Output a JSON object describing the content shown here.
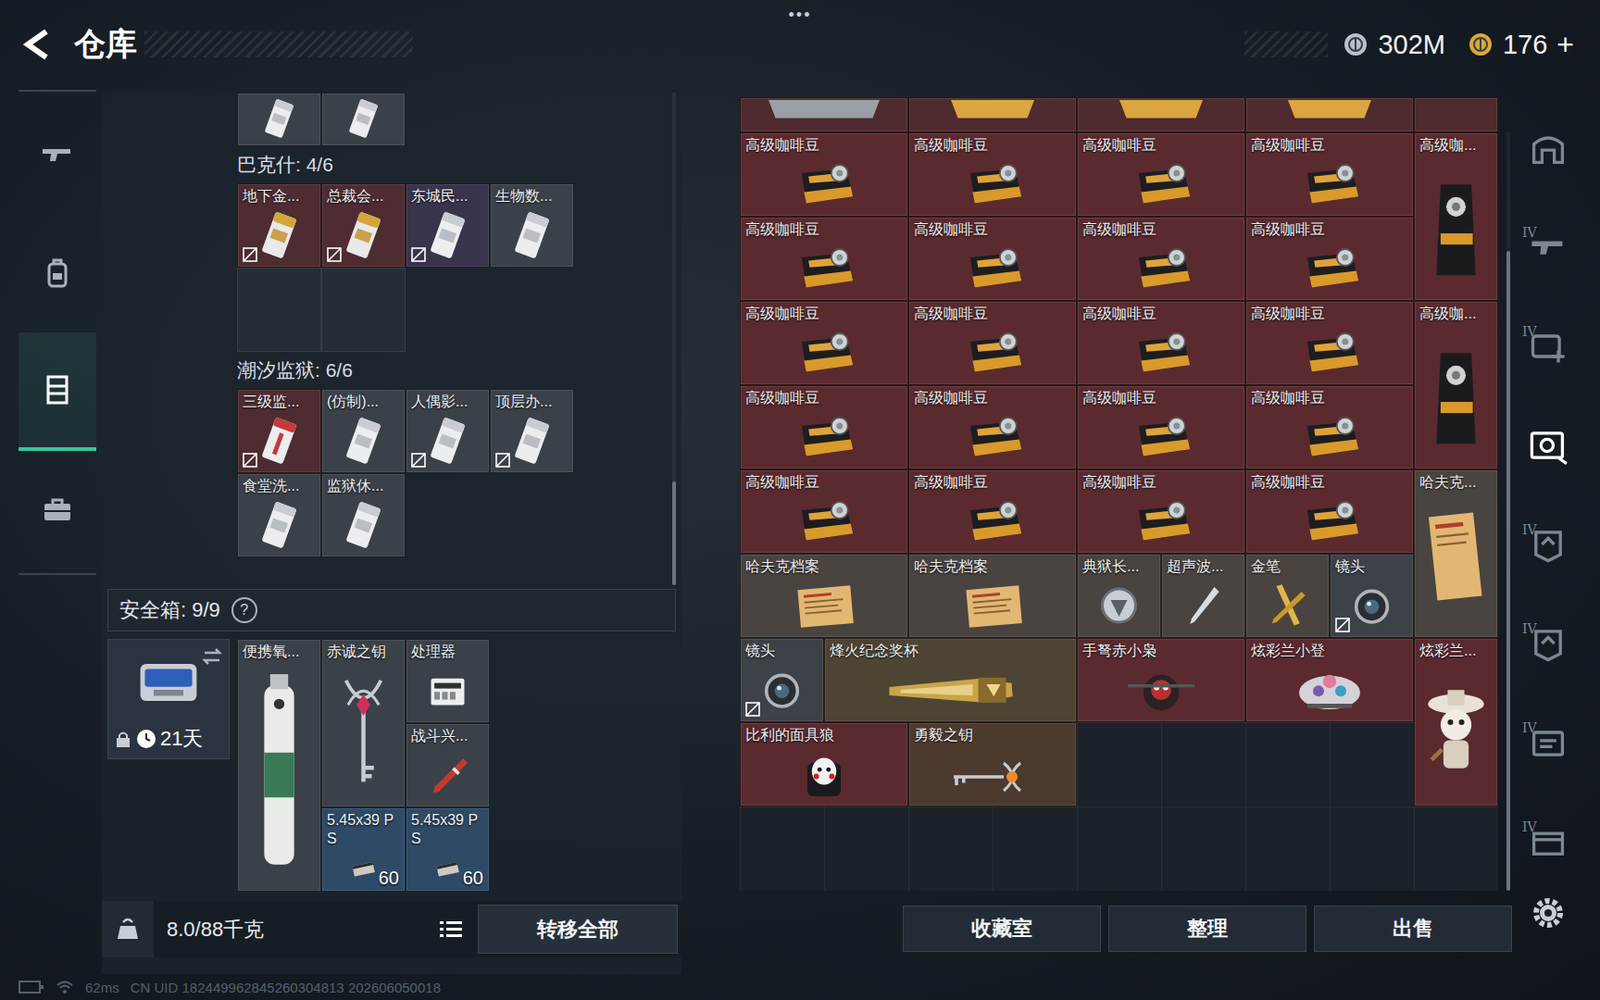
{
  "header": {
    "title": "仓库",
    "menu": "•••",
    "currencies": [
      {
        "amount": "302M",
        "kind": "silver"
      },
      {
        "amount": "176",
        "kind": "gold"
      }
    ],
    "add_button": "+"
  },
  "left_nav": [
    {
      "kind": "weapon",
      "selected": false
    },
    {
      "kind": "backpack",
      "selected": false
    },
    {
      "kind": "storage",
      "selected": true
    },
    {
      "kind": "briefcase",
      "selected": false
    }
  ],
  "storage": {
    "partial_row": [
      {
        "kind": "keycard-white",
        "color": "#3b4148"
      },
      {
        "kind": "keycard-white",
        "color": "#3b4148"
      }
    ],
    "sections": [
      {
        "title": "巴克什: 4/6",
        "items": [
          {
            "label": "地下金...",
            "kind": "keycard-gold",
            "color": "#4e2c31",
            "marked": true
          },
          {
            "label": "总裁会...",
            "kind": "keycard-gold",
            "color": "#4e2c31",
            "marked": true
          },
          {
            "label": "东城民...",
            "kind": "keycard-white",
            "color": "#38344c",
            "marked": true
          },
          {
            "label": "生物数...",
            "kind": "keycard-white",
            "color": "#3b4148",
            "marked": false
          }
        ],
        "empty_slots": 2
      },
      {
        "title": "潮汐监狱: 6/6",
        "items": [
          {
            "label": "三级监...",
            "kind": "keycard-red",
            "color": "#4e2c31",
            "marked": true
          },
          {
            "label": "(仿制)...",
            "kind": "keycard-white",
            "color": "#3b4148",
            "marked": false
          },
          {
            "label": "人偶影...",
            "kind": "keycard-white",
            "color": "#3b4148",
            "marked": true
          },
          {
            "label": "顶层办...",
            "kind": "keycard-white",
            "color": "#3b4148",
            "marked": true
          },
          {
            "label": "食堂洗...",
            "kind": "keycard-white",
            "color": "#3b4148",
            "marked": false
          },
          {
            "label": "监狱休...",
            "kind": "keycard-white",
            "color": "#3b4148",
            "marked": false
          }
        ],
        "empty_slots": 0
      }
    ]
  },
  "safe": {
    "title": "安全箱: 9/9",
    "help": "?",
    "case": {
      "locked": true,
      "expiry": "21天"
    },
    "items": [
      {
        "label": "便携氧...",
        "kind": "oxygen",
        "color": "#3b4148"
      },
      {
        "label": "赤诚之钥",
        "kind": "key-tall",
        "color": "#3b4148"
      },
      {
        "label": "处理器",
        "kind": "processor",
        "color": "#3b4148"
      },
      {
        "label": "战斗兴...",
        "kind": "injector",
        "color": "#3b4148"
      },
      {
        "label": "5.45x39 PS",
        "kind": "ammo",
        "color": "#2f4a66",
        "count": "60"
      },
      {
        "label": "5.45x39 PS",
        "kind": "ammo",
        "color": "#2f4a66",
        "count": "60"
      }
    ]
  },
  "bottom_left": {
    "weight": "8.0/88千克",
    "transfer": "转移全部"
  },
  "grid": {
    "partial_row": [
      {
        "kind": "metal-wide",
        "color": "#4f2a2e"
      },
      {
        "kind": "gold",
        "color": "#4f2a2e"
      },
      {
        "kind": "gold",
        "color": "#4f2a2e"
      },
      {
        "kind": "gold",
        "color": "#4f2a2e"
      },
      {
        "kind": "blank",
        "color": "#4f2a2e"
      }
    ],
    "items": [
      {
        "label": "高级咖啡豆",
        "kind": "coffee",
        "color": "#5a2a2f",
        "marked": false
      },
      {
        "label": "高级咖啡豆",
        "kind": "coffee",
        "color": "#5a2a2f",
        "marked": false
      },
      {
        "label": "高级咖啡豆",
        "kind": "coffee",
        "color": "#5a2a2f",
        "marked": false
      },
      {
        "label": "高级咖啡豆",
        "kind": "coffee",
        "color": "#5a2a2f",
        "marked": false
      },
      {
        "label": "高级咖...",
        "kind": "coffee-tall",
        "color": "#5a2a2f",
        "marked": false
      },
      {
        "label": "高级咖啡豆",
        "kind": "coffee",
        "color": "#5a2a2f",
        "marked": false
      },
      {
        "label": "高级咖啡豆",
        "kind": "coffee",
        "color": "#5a2a2f",
        "marked": false
      },
      {
        "label": "高级咖啡豆",
        "kind": "coffee",
        "color": "#5a2a2f",
        "marked": false
      },
      {
        "label": "高级咖啡豆",
        "kind": "coffee",
        "color": "#5a2a2f",
        "marked": false
      },
      {
        "label": "高级咖啡豆",
        "kind": "coffee",
        "color": "#5a2a2f",
        "marked": false
      },
      {
        "label": "高级咖啡豆",
        "kind": "coffee",
        "color": "#5a2a2f",
        "marked": false
      },
      {
        "label": "高级咖啡豆",
        "kind": "coffee",
        "color": "#5a2a2f",
        "marked": false
      },
      {
        "label": "高级咖啡豆",
        "kind": "coffee",
        "color": "#5a2a2f",
        "marked": false
      },
      {
        "label": "高级咖...",
        "kind": "coffee-tall",
        "color": "#5a2a2f",
        "marked": false
      },
      {
        "label": "高级咖啡豆",
        "kind": "coffee",
        "color": "#5a2a2f",
        "marked": false
      },
      {
        "label": "高级咖啡豆",
        "kind": "coffee",
        "color": "#5a2a2f",
        "marked": false
      },
      {
        "label": "高级咖啡豆",
        "kind": "coffee",
        "color": "#5a2a2f",
        "marked": false
      },
      {
        "label": "高级咖啡豆",
        "kind": "coffee",
        "color": "#5a2a2f",
        "marked": false
      },
      {
        "label": "高级咖啡豆",
        "kind": "coffee",
        "color": "#5a2a2f",
        "marked": false
      },
      {
        "label": "高级咖啡豆",
        "kind": "coffee",
        "color": "#5a2a2f",
        "marked": false
      },
      {
        "label": "高级咖啡豆",
        "kind": "coffee",
        "color": "#5a2a2f",
        "marked": false
      },
      {
        "label": "高级咖啡豆",
        "kind": "coffee",
        "color": "#5a2a2f",
        "marked": false
      },
      {
        "label": "哈夫克...",
        "kind": "file-tall",
        "color": "#4a4440",
        "marked": false
      },
      {
        "label": "哈夫克档案",
        "kind": "file",
        "color": "#4a4440",
        "marked": false
      },
      {
        "label": "哈夫克档案",
        "kind": "file",
        "color": "#4a4440",
        "marked": false
      },
      {
        "label": "典狱长...",
        "kind": "badge",
        "color": "#4a4440",
        "marked": false
      },
      {
        "label": "超声波...",
        "kind": "pen",
        "color": "#4a4440",
        "marked": false
      },
      {
        "label": "金笔",
        "kind": "goldpen",
        "color": "#4a4440",
        "marked": false
      },
      {
        "label": "镜头",
        "kind": "lens",
        "color": "#3d4248",
        "marked": true
      },
      {
        "label": "镜头",
        "kind": "lens",
        "color": "#3d4248",
        "marked": true
      },
      {
        "label": "烽火纪念奖杯",
        "kind": "trophy",
        "color": "#4d4434",
        "marked": false
      },
      {
        "label": "手弩赤小枭",
        "kind": "crossbow",
        "color": "#5a2a2f",
        "marked": false
      },
      {
        "label": "炫彩兰小登",
        "kind": "toy-wide",
        "color": "#5a2a2f",
        "marked": false
      },
      {
        "label": "炫彩兰...",
        "kind": "toy-tall",
        "color": "#5a2a2f",
        "marked": false
      },
      {
        "label": "比利的面具狼",
        "kind": "mask",
        "color": "#5a2a2f",
        "marked": false
      },
      {
        "label": "勇毅之钥",
        "kind": "key-wide",
        "color": "#4d3a2e",
        "marked": false
      }
    ]
  },
  "buttons": [
    "收藏室",
    "整理",
    "出售"
  ],
  "right_rail": [
    {
      "kind": "home",
      "badge": "",
      "selected": false
    },
    {
      "kind": "weapon",
      "badge": "IV",
      "selected": false
    },
    {
      "kind": "medkit",
      "badge": "IV",
      "selected": false
    },
    {
      "kind": "camera",
      "badge": "",
      "selected": true
    },
    {
      "kind": "armor",
      "badge": "IV",
      "selected": false
    },
    {
      "kind": "armor",
      "badge": "IV",
      "selected": false
    },
    {
      "kind": "plate",
      "badge": "IV",
      "selected": false
    },
    {
      "kind": "box",
      "badge": "IV",
      "selected": false
    }
  ],
  "status_bar": {
    "ping": "62ms",
    "uid": "CN UID 182449962845260304813 202606050018"
  }
}
